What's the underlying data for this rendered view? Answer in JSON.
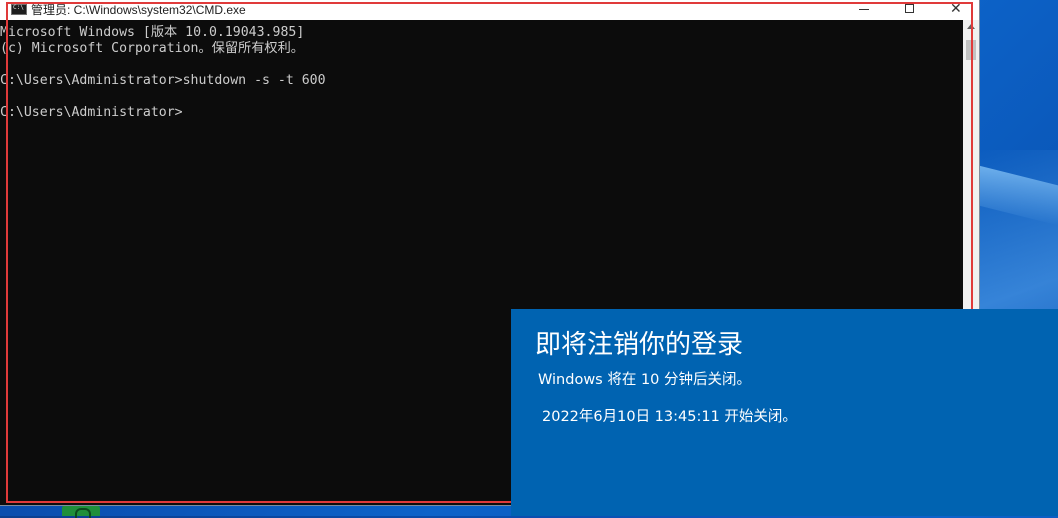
{
  "window": {
    "title": "管理员: C:\\Windows\\system32\\CMD.exe",
    "minimize_glyph": "—",
    "close_glyph": "✕"
  },
  "console": {
    "lines": [
      "Microsoft Windows [版本 10.0.19043.985]",
      "(c) Microsoft Corporation。保留所有权利。",
      "",
      "C:\\Users\\Administrator>shutdown -s -t 600",
      "",
      "C:\\Users\\Administrator>"
    ]
  },
  "toast": {
    "title": "即将注销你的登录",
    "message": "Windows 将在 10 分钟后关闭。",
    "time": "2022年6月10日 13:45:11 开始关闭。"
  },
  "colors": {
    "console_bg": "#0c0c0c",
    "console_text": "#cccccc",
    "toast_bg": "#0063b1",
    "highlight": "#e03a3a"
  },
  "icons": {
    "window": "cmd-icon",
    "taskbar": "terminal-app-icon"
  }
}
